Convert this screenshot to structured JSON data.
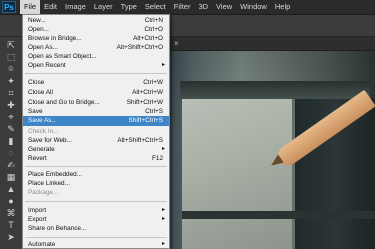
{
  "menubar": {
    "logo": "Ps",
    "items": [
      {
        "label": "File",
        "active": true
      },
      {
        "label": "Edit"
      },
      {
        "label": "Image"
      },
      {
        "label": "Layer"
      },
      {
        "label": "Type"
      },
      {
        "label": "Select"
      },
      {
        "label": "Filter"
      },
      {
        "label": "3D"
      },
      {
        "label": "View"
      },
      {
        "label": "Window"
      },
      {
        "label": "Help"
      }
    ]
  },
  "file_menu": {
    "items": [
      {
        "label": "New...",
        "shortcut": "Ctrl+N"
      },
      {
        "label": "Open...",
        "shortcut": "Ctrl+O"
      },
      {
        "label": "Browse in Bridge...",
        "shortcut": "Alt+Ctrl+O"
      },
      {
        "label": "Open As...",
        "shortcut": "Alt+Shift+Ctrl+O"
      },
      {
        "label": "Open as Smart Object...",
        "shortcut": ""
      },
      {
        "label": "Open Recent",
        "shortcut": "",
        "submenu": true
      },
      {
        "label": "Close",
        "shortcut": "Ctrl+W"
      },
      {
        "label": "Close All",
        "shortcut": "Alt+Ctrl+W"
      },
      {
        "label": "Close and Go to Bridge...",
        "shortcut": "Shift+Ctrl+W"
      },
      {
        "label": "Save",
        "shortcut": "Ctrl+S"
      },
      {
        "label": "Save As...",
        "shortcut": "Shift+Ctrl+S",
        "highlight": true
      },
      {
        "label": "Check In...",
        "shortcut": "",
        "disabled": true
      },
      {
        "label": "Save for Web...",
        "shortcut": "Alt+Shift+Ctrl+S"
      },
      {
        "label": "Generate",
        "shortcut": "",
        "submenu": true
      },
      {
        "label": "Revert",
        "shortcut": "F12"
      },
      {
        "label": "Place Embedded...",
        "shortcut": ""
      },
      {
        "label": "Place Linked...",
        "shortcut": ""
      },
      {
        "label": "Package...",
        "shortcut": "",
        "disabled": true
      },
      {
        "label": "Import",
        "shortcut": "",
        "submenu": true
      },
      {
        "label": "Export",
        "shortcut": "",
        "submenu": true
      },
      {
        "label": "Share on Behance...",
        "shortcut": ""
      },
      {
        "label": "Automate",
        "shortcut": "",
        "submenu": true
      }
    ],
    "submenu_arrow": "▸"
  },
  "canvas": {
    "tab_close": "×"
  },
  "tools": {
    "glyphs": [
      "⇱",
      "⬚",
      "⌾",
      "✦",
      "⌗",
      "✚",
      "⌖",
      "✎",
      "▮",
      "◌",
      "✍",
      "▦",
      "▲",
      "●",
      "⌘",
      "T",
      "➤",
      "▭",
      "✋",
      "⌕"
    ]
  }
}
